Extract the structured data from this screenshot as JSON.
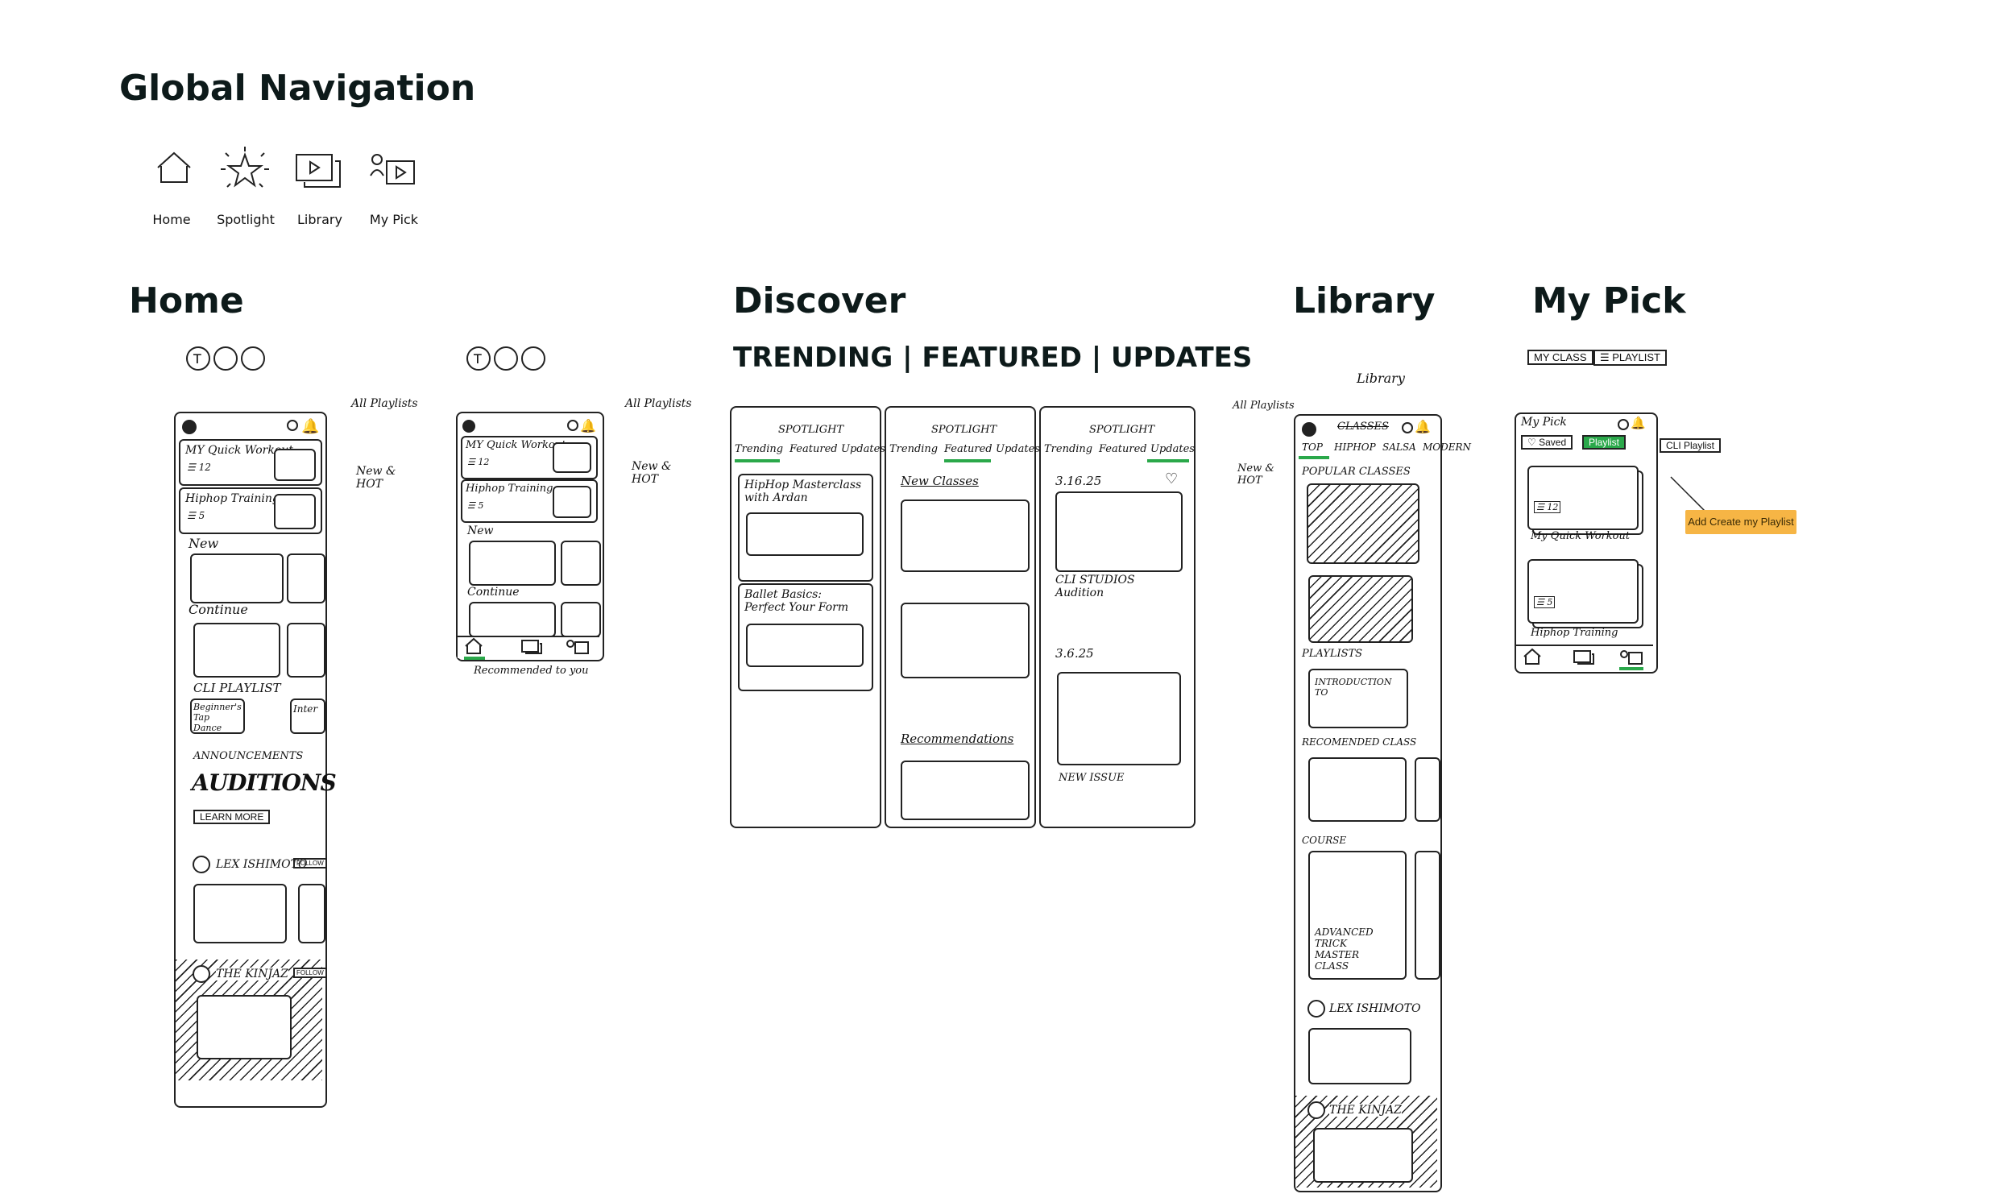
{
  "global_nav": {
    "title": "Global Navigation",
    "items": [
      {
        "label": "Home",
        "icon": "home-icon"
      },
      {
        "label": "Spotlight",
        "icon": "star-icon"
      },
      {
        "label": "Library",
        "icon": "media-stack-icon"
      },
      {
        "label": "My Pick",
        "icon": "person-play-icon"
      }
    ]
  },
  "sections": {
    "home": "Home",
    "discover": "Discover",
    "discover_subtitle": "TRENDING | FEATURED | UPDATES",
    "library": "Library",
    "mypick": "My Pick"
  },
  "home_sketch": {
    "all_playlists": "All Playlists",
    "new_hot": "New & HOT",
    "card1": "MY Quick Workout",
    "card1_meta": "☰ 12",
    "card2": "Hiphop Training",
    "card2_meta": "☰ 5",
    "new": "New",
    "continue": "Continue",
    "cli_playlist": "CLI PLAYLIST",
    "beginner": "Beginner's Tap Dance",
    "inter": "Inter",
    "announcements": "ANNOUNCEMENTS",
    "auditions": "AUDITIONS",
    "learn_more": "LEARN MORE",
    "instructor1": "LEX ISHIMOTO",
    "instructor2": "THE KINJAZ",
    "follow": "FOLLOW",
    "recommended": "Recommended to you"
  },
  "discover_sketch": {
    "spotlight": "SPOTLIGHT",
    "tabs": [
      "Trending",
      "Featured",
      "Updates"
    ],
    "col1_item1": "HipHop Masterclass with Ardan",
    "col1_item2": "Ballet Basics: Perfect Your Form",
    "col2_new": "New Classes",
    "col2_reco": "Recommendations",
    "col3_date1": "3.16.25",
    "col3_text": "CLI STUDIOS Audition",
    "col3_date2": "3.6.25",
    "col3_new": "NEW ISSUE"
  },
  "library_sketch": {
    "label": "Library",
    "all_playlists": "All Playlists",
    "new_hot": "New & HOT",
    "classes": "CLASSES",
    "tabs": [
      "TOP",
      "HIPHOP",
      "SALSA",
      "MODERN"
    ],
    "popular": "POPULAR CLASSES",
    "playlists": "PLAYLISTS",
    "intro": "INTRODUCTION TO",
    "reco": "RECOMENDED CLASS",
    "course": "COURSE",
    "advanced": "ADVANCED TRICK MASTER CLASS",
    "instructor1": "LEX ISHIMOTO",
    "instructor2": "THE KINJAZ"
  },
  "mypick_sketch": {
    "my_class": "MY CLASS",
    "playlist": "☰ PLAYLIST",
    "my_pick": "My Pick",
    "saved": "♡ Saved",
    "playlist_btn": "Playlist",
    "cli_playlist": "CLI Playlist",
    "meta1": "☰ 12",
    "title1": "My Quick Workout",
    "meta2": "☰ 5",
    "title2": "Hiphop Training",
    "tooltip": "Add Create my Playlist"
  },
  "colors": {
    "accent_green": "#2aa84a",
    "tooltip": "#f6b545",
    "title": "#0d1a1a"
  }
}
